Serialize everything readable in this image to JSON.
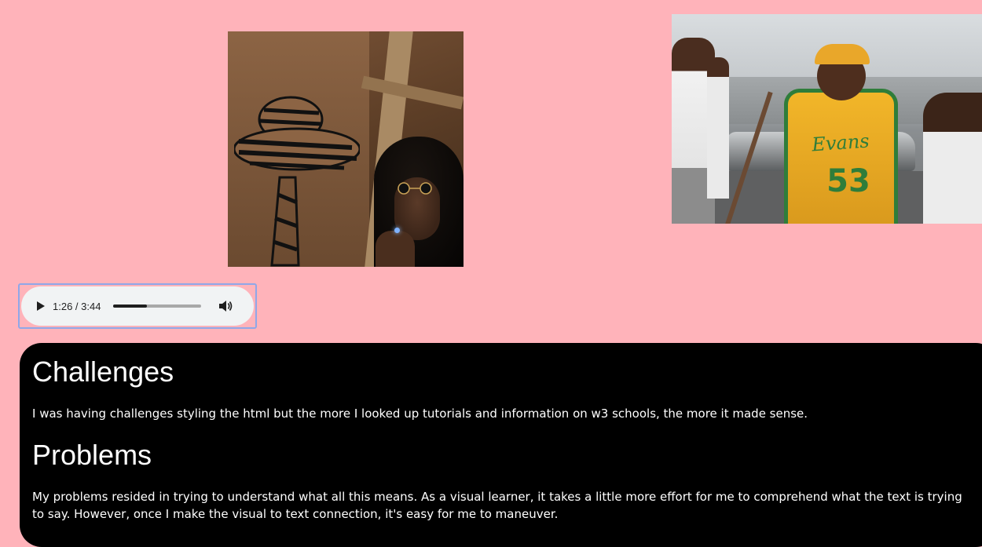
{
  "images": {
    "album_cover": {
      "icon": "album-art-image"
    },
    "video_still": {
      "icon": "video-still-image",
      "jersey_text": "Evans",
      "jersey_number": "53"
    }
  },
  "audio_player": {
    "time_display": "1:26 / 3:44",
    "progress": 0.38,
    "play_icon": "play-icon",
    "volume_icon": "volume-icon"
  },
  "content": {
    "challenges_heading": "Challenges",
    "challenges_text": "I was having challenges styling the html but the more I looked up tutorials and information on w3 schools, the more it made sense.",
    "problems_heading": "Problems",
    "problems_text": "My problems resided in trying to understand what all this means. As a visual learner, it takes a little more effort for me to comprehend what the text is trying to say. However, once I make the visual to text connection, it's easy for me to maneuver."
  },
  "colors": {
    "page_background": "#ffb3ba",
    "panel_background": "#000000",
    "panel_text": "#ffffff",
    "player_background": "#f1f3f4",
    "focus_outline": "#8fa7e8"
  }
}
